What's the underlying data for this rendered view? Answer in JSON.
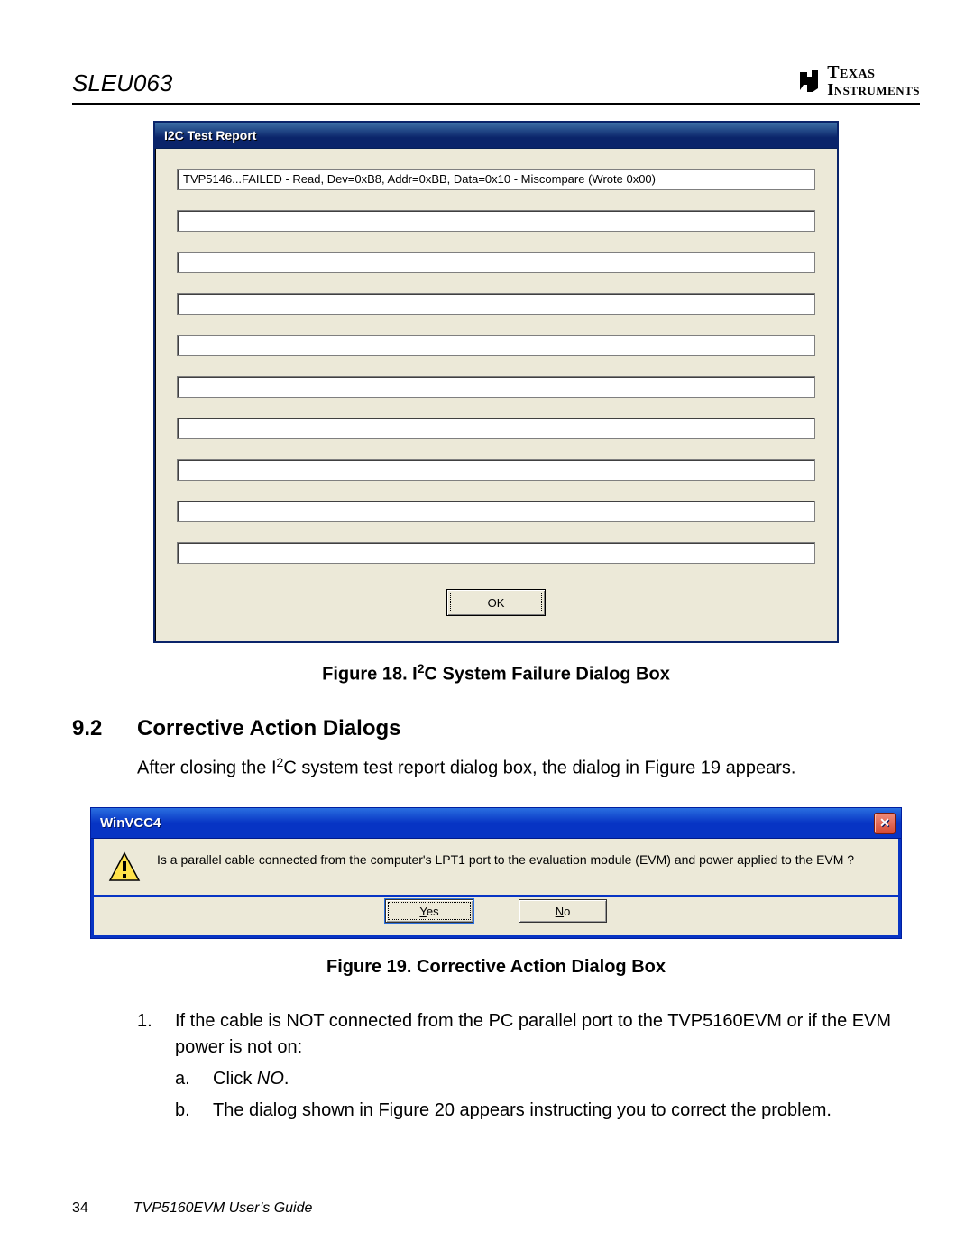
{
  "header": {
    "doc_id": "SLEU063",
    "logo_top": "Texas",
    "logo_bottom": "Instruments"
  },
  "dialog1": {
    "title": "I2C Test Report",
    "rows": [
      "TVP5146...FAILED - Read,  Dev=0xB8, Addr=0xBB, Data=0x10 - Miscompare (Wrote 0x00)",
      "",
      "",
      "",
      "",
      "",
      "",
      "",
      "",
      ""
    ],
    "ok_label": "OK"
  },
  "caption1": {
    "prefix": "Figure 18.   I",
    "sup": "2",
    "suffix": "C System Failure Dialog Box"
  },
  "section": {
    "number": "9.2",
    "title": "Corrective Action Dialogs"
  },
  "para1": {
    "prefix": "After closing the I",
    "sup": "2",
    "suffix": "C system test report dialog box, the dialog in Figure 19 appears."
  },
  "dialog2": {
    "title": "WinVCC4",
    "close_glyph": "✕",
    "message": "Is a parallel cable connected from the computer's LPT1 port to the evaluation module (EVM) and power applied to the EVM ?",
    "yes_label": "Yes",
    "no_label": "No"
  },
  "caption2": "Figure 19.    Corrective Action Dialog Box",
  "list": {
    "item1_marker": "1.",
    "item1_text": "If the cable is NOT connected from the PC parallel port to the TVP5160EVM or if the EVM power is not on:",
    "sub_a_marker": "a.",
    "sub_a_prefix": "Click ",
    "sub_a_em": "NO",
    "sub_a_suffix": ".",
    "sub_b_marker": "b.",
    "sub_b_text": "The dialog shown in Figure 20 appears instructing you to correct the problem."
  },
  "footer": {
    "page": "34",
    "guide": "TVP5160EVM User’s Guide"
  }
}
